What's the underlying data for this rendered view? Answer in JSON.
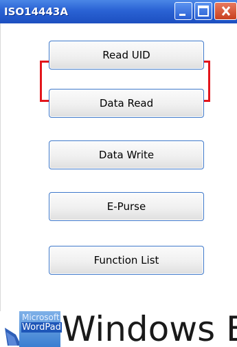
{
  "window": {
    "title": "ISO14443A"
  },
  "buttons": [
    {
      "label": "Read UID"
    },
    {
      "label": "Data Read"
    },
    {
      "label": "Data Write"
    },
    {
      "label": "E-Purse"
    },
    {
      "label": "Function List"
    }
  ],
  "desktop": {
    "icon_top_text": "Microsoft",
    "icon_label": "WordPad",
    "banner_text": "Windows E"
  },
  "colors": {
    "titlebar": "#2a62d4",
    "focus_frame": "#e3151b",
    "close_button": "#c8401f"
  },
  "icons": [
    "minimize-icon",
    "maximize-icon",
    "close-icon",
    "wordpad-icon"
  ]
}
